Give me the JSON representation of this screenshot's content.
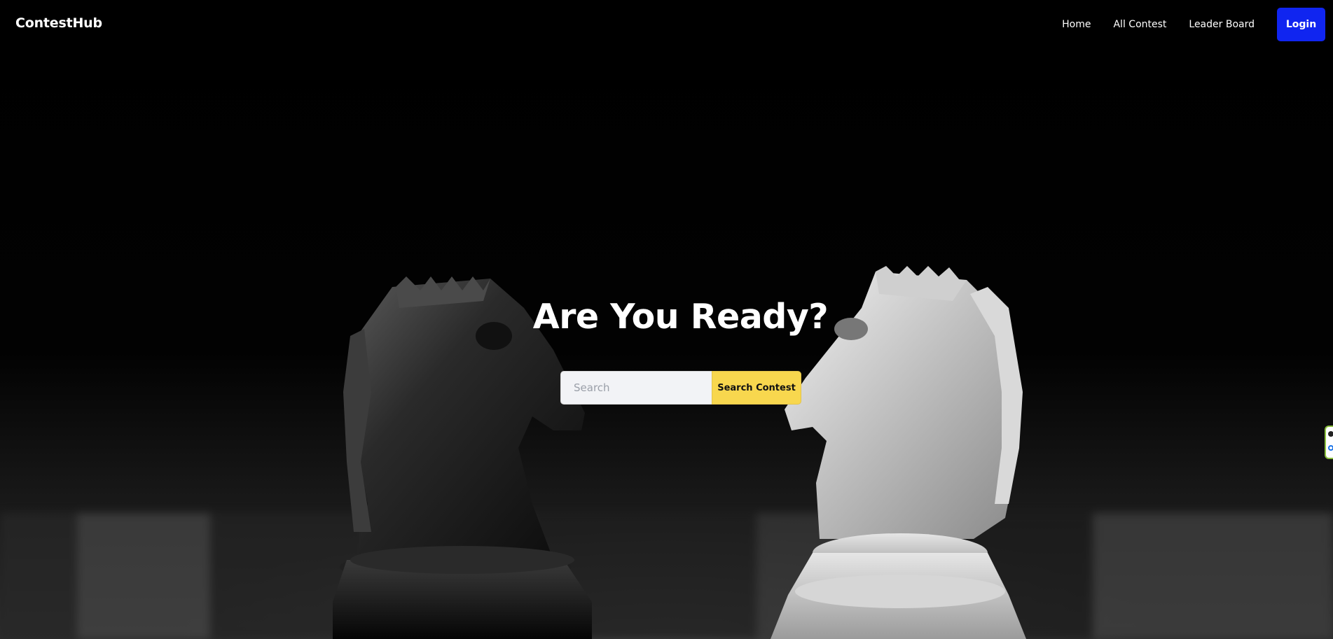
{
  "app": {
    "brand": "ContestHub"
  },
  "nav": {
    "items": [
      {
        "label": "Home"
      },
      {
        "label": "All Contest"
      },
      {
        "label": "Leader Board"
      }
    ],
    "login_label": "Login"
  },
  "hero": {
    "title": "Are You Ready?",
    "search": {
      "placeholder": "Search",
      "value": "",
      "button_label": "Search Contest"
    }
  },
  "colors": {
    "login_button": "#1025f0",
    "search_button": "#f8d74e",
    "background": "#000000"
  },
  "icons": {
    "edge_widget": "extension-widget-icon"
  }
}
